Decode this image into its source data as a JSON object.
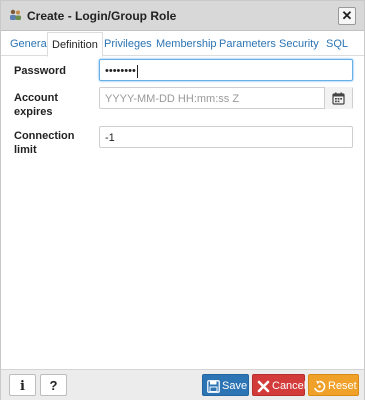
{
  "titlebar": {
    "title": "Create - Login/Group Role",
    "close_glyph": "✕"
  },
  "tabs": [
    {
      "label": "General"
    },
    {
      "label": "Definition"
    },
    {
      "label": "Privileges"
    },
    {
      "label": "Membership"
    },
    {
      "label": "Parameters"
    },
    {
      "label": "Security"
    },
    {
      "label": "SQL"
    }
  ],
  "active_tab": "Definition",
  "form": {
    "password": {
      "label": "Password",
      "value": "••••••••"
    },
    "account_expires": {
      "label_line1": "Account",
      "label_line2": "expires",
      "placeholder": "YYYY-MM-DD HH:mm:ss Z"
    },
    "connection_limit": {
      "label_line1": "Connection",
      "label_line2": "limit",
      "value": "-1"
    }
  },
  "footer": {
    "info_glyph": "i",
    "help_glyph": "?",
    "save_label": "Save",
    "cancel_label": "Cancel",
    "reset_label": "Reset"
  },
  "colors": {
    "accent": "#2c74b3",
    "cancel": "#d33a3a",
    "reset": "#f0a12a",
    "focus": "#66afe9"
  },
  "icons": [
    "users-icon",
    "close-icon",
    "calendar-icon",
    "info-icon",
    "help-icon",
    "save-icon",
    "cancel-icon",
    "reset-icon"
  ]
}
